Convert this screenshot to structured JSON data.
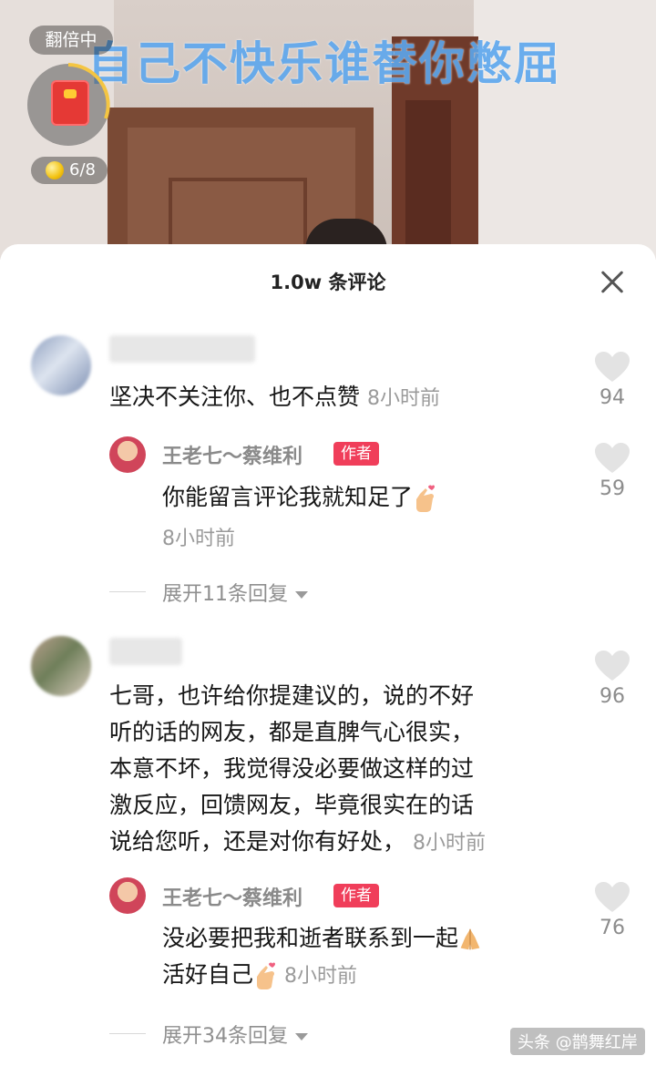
{
  "video": {
    "overlay_title": "自己不快乐谁替你憋屈",
    "double_badge": "翻倍中",
    "coin_progress": "6/8"
  },
  "sheet": {
    "title": "1.0w 条评论"
  },
  "comments": [
    {
      "text": "坚决不关注你、也不点赞",
      "time": "8小时前",
      "likes": "94",
      "reply": {
        "author": "王老七～蔡维利",
        "tag": "作者",
        "text": "你能留言评论我就知足了",
        "time": "8小时前",
        "likes": "59"
      },
      "expand": "展开11条回复"
    },
    {
      "lines": [
        "七哥，也许给你提建议的，说的不好",
        "听的话的网友，都是直脾气心很实，",
        "本意不坏，我觉得没必要做这样的过",
        "激反应，回馈网友，毕竟很实在的话",
        "说给您听，还是对你有好处，"
      ],
      "time": "8小时前",
      "likes": "96",
      "reply": {
        "author": "王老七～蔡维利",
        "tag": "作者",
        "line1": "没必要把我和逝者联系到一起",
        "line2": "活好自己",
        "time": "8小时前",
        "likes": "76"
      },
      "expand": "展开34条回复"
    }
  ],
  "watermark": "头条 @鹊舞红岸",
  "icons": [
    "heart-icon",
    "close-icon",
    "red-packet-icon",
    "coin-icon",
    "finger-heart-emoji",
    "pray-emoji",
    "caret-down-icon"
  ]
}
